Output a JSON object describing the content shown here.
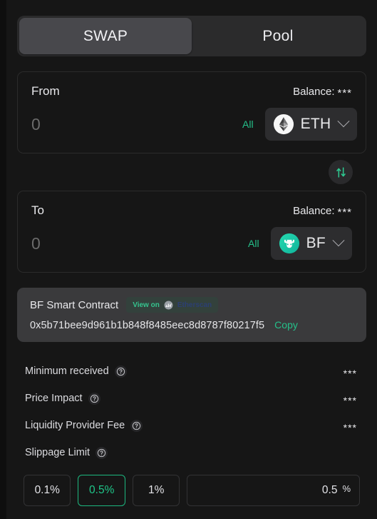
{
  "tabs": {
    "swap_label": "SWAP",
    "pool_label": "Pool",
    "active": "SWAP"
  },
  "from": {
    "label": "From",
    "balance_label": "Balance:",
    "balance_value": "***",
    "amount_value": "",
    "amount_placeholder": "0",
    "all_label": "All",
    "token_symbol": "ETH",
    "token_icon": "ethereum-icon"
  },
  "swap_toggle": {
    "icon": "swap-vertical-icon"
  },
  "to": {
    "label": "To",
    "balance_label": "Balance:",
    "balance_value": "***",
    "amount_value": "",
    "amount_placeholder": "0",
    "all_label": "All",
    "token_symbol": "BF",
    "token_icon": "bullfinch-icon"
  },
  "contract": {
    "title": "BF Smart Contract",
    "view_on_label": "View on",
    "explorer_name": "Etherscan",
    "explorer_icon": "etherscan-icon",
    "address": "0x5b71bee9d961b1b848f8485eec8d8787f80217f5",
    "copy_label": "Copy"
  },
  "details": [
    {
      "label": "Minimum received",
      "value": "***",
      "help": "help-icon"
    },
    {
      "label": "Price Impact",
      "value": "***",
      "help": "help-icon"
    },
    {
      "label": "Liquidity Provider Fee",
      "value": "***",
      "help": "help-icon"
    },
    {
      "label": "Slippage Limit",
      "value": "",
      "help": "help-icon"
    }
  ],
  "slippage": {
    "options": [
      {
        "label": "0.1%",
        "selected": false
      },
      {
        "label": "0.5%",
        "selected": true
      },
      {
        "label": "1%",
        "selected": false
      }
    ],
    "custom_value": "0.5",
    "custom_placeholder": "0.5",
    "percent_symbol": "%"
  },
  "colors": {
    "accent_green": "#25c08a",
    "selected_green": "#1db87f",
    "page_bg": "#161616",
    "card_bg": "#3a3a3c",
    "tab_bg": "#2b2b2c",
    "tab_active_bg": "#48484c",
    "token_bg": "#2d2d2f",
    "bf_token": "#19c9a6",
    "etherscan_blue": "#2c3f73"
  }
}
